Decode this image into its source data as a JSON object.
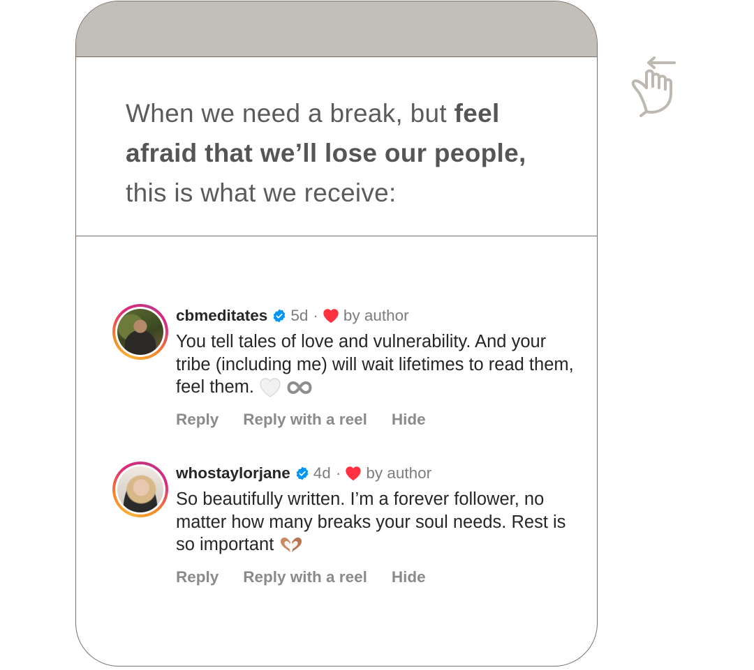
{
  "headline": {
    "part1": "When we need a break, but ",
    "bold": "feel afraid that we’ll lose our people,",
    "part2": " this is what we receive:"
  },
  "comments": [
    {
      "username": "cbmeditates",
      "time": "5d",
      "separator": "·",
      "liked_label": "by author",
      "text": "You tell tales of love and vulnerability. And your tribe (including me) will wait lifetimes to read them, feel them.",
      "trailing_emojis": [
        "white-heart",
        "infinity"
      ],
      "actions": [
        "Reply",
        "Reply with a reel",
        "Hide"
      ]
    },
    {
      "username": "whostaylorjane",
      "time": "4d",
      "separator": "·",
      "liked_label": "by author",
      "text": "So beautifully written. I’m a forever follower, no matter how many breaks your soul needs. Rest is so important",
      "trailing_emojis": [
        "heart-hands"
      ],
      "actions": [
        "Reply",
        "Reply with a reel",
        "Hide"
      ]
    }
  ],
  "colors": {
    "card_header": "#c2beb8",
    "border": "#7a6f66",
    "verified": "#0095f6",
    "heart": "#ff3040"
  },
  "icons": {
    "swipe": "swipe-left-hand-icon"
  }
}
